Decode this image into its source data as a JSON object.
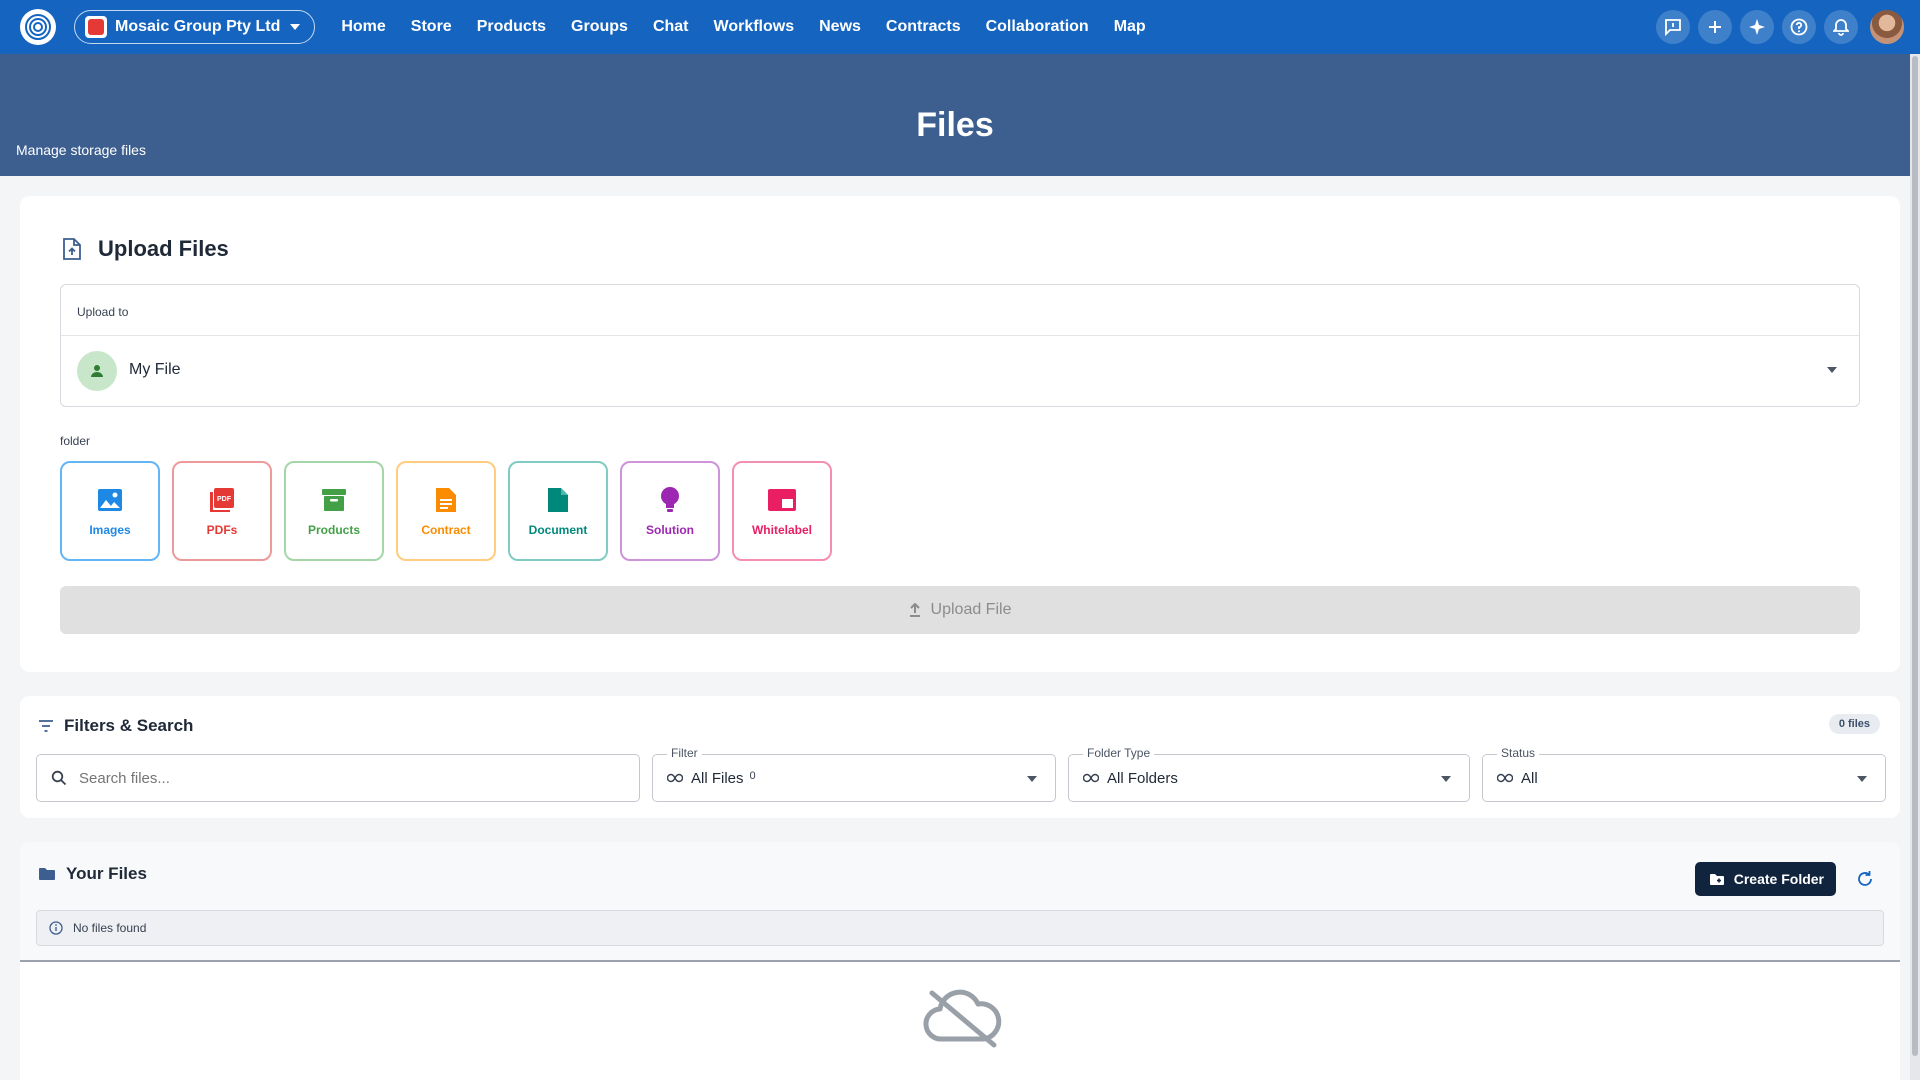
{
  "nav": {
    "org_name": "Mosaic Group Pty Ltd",
    "links": [
      "Home",
      "Store",
      "Products",
      "Groups",
      "Chat",
      "Workflows",
      "News",
      "Contracts",
      "Collaboration",
      "Map"
    ],
    "icons": [
      "feedback-icon",
      "plus-icon",
      "sparkle-icon",
      "help-icon",
      "bell-icon"
    ]
  },
  "header": {
    "title": "Files",
    "subtitle": "Manage storage files"
  },
  "upload": {
    "title": "Upload Files",
    "upload_to_label": "Upload to",
    "upload_to_value": "My File",
    "folder_label": "folder",
    "folders": [
      {
        "label": "Images",
        "color": "#1e88e5",
        "icon": "image-icon"
      },
      {
        "label": "PDFs",
        "color": "#e53935",
        "icon": "pdf-icon"
      },
      {
        "label": "Products",
        "color": "#43a047",
        "icon": "archive-icon"
      },
      {
        "label": "Contract",
        "color": "#fb8c00",
        "icon": "document-text-icon"
      },
      {
        "label": "Document",
        "color": "#00897b",
        "icon": "file-icon"
      },
      {
        "label": "Solution",
        "color": "#9c27b0",
        "icon": "lightbulb-icon"
      },
      {
        "label": "Whitelabel",
        "color": "#e91e63",
        "icon": "branding-icon"
      }
    ],
    "upload_button": "Upload File"
  },
  "filters": {
    "title": "Filters & Search",
    "count_badge": "0 files",
    "search_placeholder": "Search files...",
    "filter": {
      "label": "Filter",
      "value": "All Files",
      "count": "0"
    },
    "folder_type": {
      "label": "Folder Type",
      "value": "All Folders"
    },
    "status": {
      "label": "Status",
      "value": "All"
    }
  },
  "files": {
    "title": "Your Files",
    "create_folder": "Create Folder",
    "empty_message": "No files found"
  }
}
